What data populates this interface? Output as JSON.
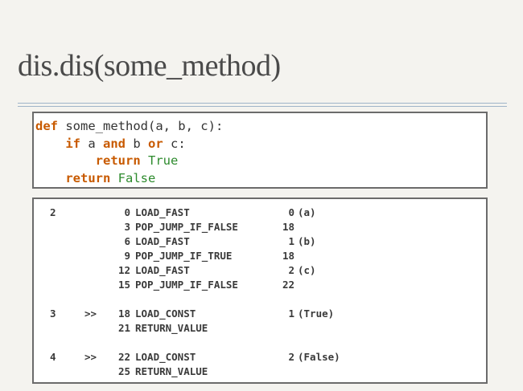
{
  "slide": {
    "title": "dis.dis(some_method)"
  },
  "source": {
    "lines": [
      {
        "indent": "",
        "parts": [
          {
            "t": "def",
            "k": "kw"
          },
          {
            "t": " some_method(a, b, c):",
            "k": ""
          }
        ]
      },
      {
        "indent": "    ",
        "parts": [
          {
            "t": "if",
            "k": "kw"
          },
          {
            "t": " a ",
            "k": ""
          },
          {
            "t": "and",
            "k": "kw"
          },
          {
            "t": " b ",
            "k": ""
          },
          {
            "t": "or",
            "k": "kw"
          },
          {
            "t": " c:",
            "k": ""
          }
        ]
      },
      {
        "indent": "        ",
        "parts": [
          {
            "t": "return",
            "k": "kw"
          },
          {
            "t": " ",
            "k": ""
          },
          {
            "t": "True",
            "k": "const"
          }
        ]
      },
      {
        "indent": "    ",
        "parts": [
          {
            "t": "return",
            "k": "kw"
          },
          {
            "t": " ",
            "k": ""
          },
          {
            "t": "False",
            "k": "const"
          }
        ]
      }
    ]
  },
  "disassembly": {
    "rows": [
      {
        "line": "2",
        "mark": "",
        "offset": "0",
        "op": "LOAD_FAST",
        "arg": "0",
        "note": "(a)"
      },
      {
        "line": "",
        "mark": "",
        "offset": "3",
        "op": "POP_JUMP_IF_FALSE",
        "arg": "18",
        "note": ""
      },
      {
        "line": "",
        "mark": "",
        "offset": "6",
        "op": "LOAD_FAST",
        "arg": "1",
        "note": "(b)"
      },
      {
        "line": "",
        "mark": "",
        "offset": "9",
        "op": "POP_JUMP_IF_TRUE",
        "arg": "18",
        "note": ""
      },
      {
        "line": "",
        "mark": "",
        "offset": "12",
        "op": "LOAD_FAST",
        "arg": "2",
        "note": "(c)"
      },
      {
        "line": "",
        "mark": "",
        "offset": "15",
        "op": "POP_JUMP_IF_FALSE",
        "arg": "22",
        "note": ""
      },
      {
        "gap": true
      },
      {
        "line": "3",
        "mark": ">>",
        "offset": "18",
        "op": "LOAD_CONST",
        "arg": "1",
        "note": "(True)"
      },
      {
        "line": "",
        "mark": "",
        "offset": "21",
        "op": "RETURN_VALUE",
        "arg": "",
        "note": ""
      },
      {
        "gap": true
      },
      {
        "line": "4",
        "mark": ">>",
        "offset": "22",
        "op": "LOAD_CONST",
        "arg": "2",
        "note": "(False)"
      },
      {
        "line": "",
        "mark": "",
        "offset": "25",
        "op": "RETURN_VALUE",
        "arg": "",
        "note": ""
      }
    ]
  }
}
